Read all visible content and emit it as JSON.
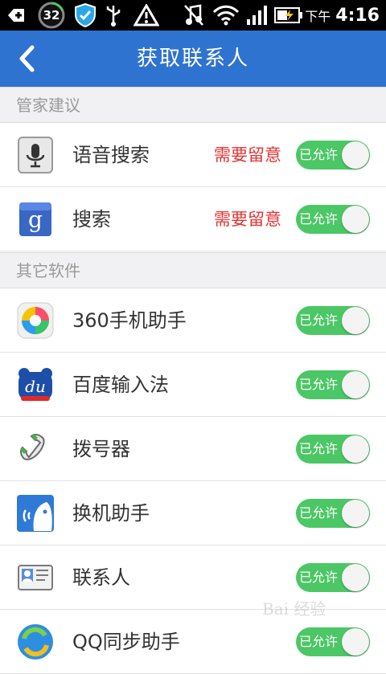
{
  "status_bar": {
    "battery_circle_value": "32",
    "ampm": "下午",
    "time": "4:16",
    "icons": [
      "add-box-icon",
      "shield-icon",
      "usb-icon",
      "warning-icon",
      "music-mute-icon",
      "wifi-icon",
      "signal-icon",
      "battery-icon"
    ]
  },
  "header": {
    "title": "获取联系人",
    "back_icon": "chevron-left-icon",
    "background": "#2e73cf"
  },
  "sections": [
    {
      "label": "管家建议"
    },
    {
      "label": "其它软件"
    }
  ],
  "apps": [
    {
      "name": "语音搜索",
      "warning": "需要留意",
      "toggle_label": "已允许",
      "icon": "microphone-icon"
    },
    {
      "name": "搜索",
      "warning": "需要留意",
      "toggle_label": "已允许",
      "icon": "google-g-icon"
    },
    {
      "name": "360手机助手",
      "warning": "",
      "toggle_label": "已允许",
      "icon": "360-assistant-icon"
    },
    {
      "name": "百度输入法",
      "warning": "",
      "toggle_label": "已允许",
      "icon": "baidu-du-icon"
    },
    {
      "name": "拨号器",
      "warning": "",
      "toggle_label": "已允许",
      "icon": "phone-handset-icon"
    },
    {
      "name": "换机助手",
      "warning": "",
      "toggle_label": "已允许",
      "icon": "phone-clone-icon"
    },
    {
      "name": "联系人",
      "warning": "",
      "toggle_label": "已允许",
      "icon": "contact-card-icon"
    },
    {
      "name": "QQ同步助手",
      "warning": "",
      "toggle_label": "已允许",
      "icon": "qq-sync-icon"
    }
  ],
  "colors": {
    "toggle_on": "#4cc766",
    "warning_text": "#e53333",
    "section_bg": "#f1f1f3"
  },
  "watermark": "Bai 经验"
}
